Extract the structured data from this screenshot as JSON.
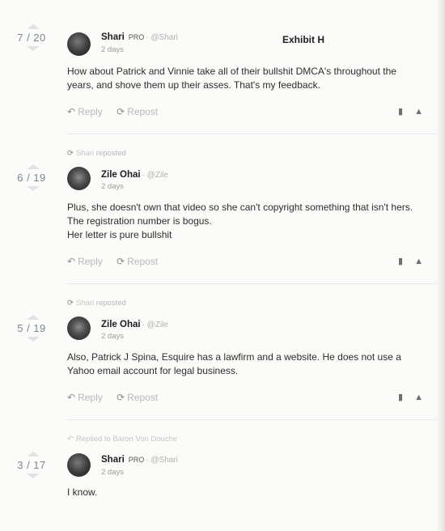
{
  "exhibit_label": "Exhibit H",
  "actions": {
    "reply": "Reply",
    "repost": "Repost"
  },
  "posts": [
    {
      "score": "7 / 20",
      "author": "Shari",
      "badge": "PRO",
      "handle": "· @Shari",
      "time": "2 days",
      "lines": [
        "How about Patrick and Vinnie take all of their bullshit DMCA's throughout the",
        "years, and shove them up their asses. That's my feedback."
      ]
    },
    {
      "score": "6 / 19",
      "repost_by": "Shari",
      "repost_text": "reposted",
      "author": "Zile Ohai",
      "handle": "· @Zile",
      "time": "2 days",
      "lines": [
        "Plus, she doesn't own that video so she can't copyright something that isn't hers.",
        "The registration number is bogus.",
        "Her letter is pure bullshit"
      ]
    },
    {
      "score": "5 / 19",
      "repost_by": "Shari",
      "repost_text": "reposted",
      "author": "Zile Ohai",
      "handle": "· @Zile",
      "time": "2 days",
      "lines": [
        "Also, Patrick J Spina, Esquire has a lawfirm and a website. He does not use a",
        "Yahoo email account for legal business."
      ]
    },
    {
      "score": "3 / 17",
      "reply_note": "Replied to Baron Von Douche",
      "author": "Shari",
      "badge": "PRO",
      "handle": "· @Shari",
      "time": "2 days",
      "lines": [
        "I know."
      ]
    }
  ]
}
